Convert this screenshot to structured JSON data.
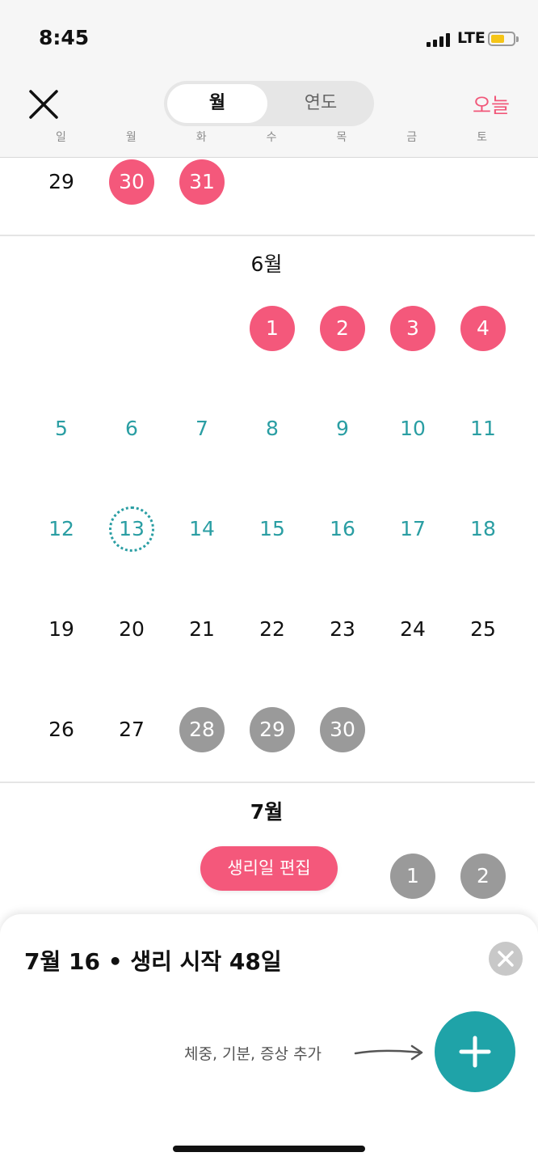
{
  "status_bar": {
    "time": "8:45",
    "network": "LTE"
  },
  "header": {
    "segments": {
      "month": "월",
      "year": "연도"
    },
    "today": "오늘",
    "weekdays": [
      "일",
      "월",
      "화",
      "수",
      "목",
      "금",
      "토"
    ]
  },
  "calendar": {
    "may_tail": {
      "days": [
        {
          "n": "29",
          "state": "normal"
        },
        {
          "n": "30",
          "state": "period"
        },
        {
          "n": "31",
          "state": "period"
        }
      ]
    },
    "june": {
      "title": "6월",
      "days": [
        {
          "n": "1",
          "state": "period"
        },
        {
          "n": "2",
          "state": "period"
        },
        {
          "n": "3",
          "state": "period"
        },
        {
          "n": "4",
          "state": "period"
        },
        {
          "n": "5",
          "state": "fertile"
        },
        {
          "n": "6",
          "state": "fertile"
        },
        {
          "n": "7",
          "state": "fertile"
        },
        {
          "n": "8",
          "state": "fertile"
        },
        {
          "n": "9",
          "state": "fertile"
        },
        {
          "n": "10",
          "state": "fertile"
        },
        {
          "n": "11",
          "state": "fertile"
        },
        {
          "n": "12",
          "state": "fertile"
        },
        {
          "n": "13",
          "state": "today"
        },
        {
          "n": "14",
          "state": "fertile"
        },
        {
          "n": "15",
          "state": "fertile"
        },
        {
          "n": "16",
          "state": "fertile"
        },
        {
          "n": "17",
          "state": "fertile"
        },
        {
          "n": "18",
          "state": "fertile"
        },
        {
          "n": "19",
          "state": "normal"
        },
        {
          "n": "20",
          "state": "normal"
        },
        {
          "n": "21",
          "state": "normal"
        },
        {
          "n": "22",
          "state": "normal"
        },
        {
          "n": "23",
          "state": "normal"
        },
        {
          "n": "24",
          "state": "normal"
        },
        {
          "n": "25",
          "state": "normal"
        },
        {
          "n": "26",
          "state": "normal"
        },
        {
          "n": "27",
          "state": "normal"
        },
        {
          "n": "28",
          "state": "predicted"
        },
        {
          "n": "29",
          "state": "predicted"
        },
        {
          "n": "30",
          "state": "predicted"
        }
      ]
    },
    "july": {
      "title": "7월",
      "days": [
        {
          "n": "1",
          "state": "predicted"
        },
        {
          "n": "2",
          "state": "predicted"
        }
      ]
    },
    "edit_period_label": "생리일 편집"
  },
  "sheet": {
    "title": "7월 16 • 생리 시작 48일",
    "hint": "체중, 기분, 증상 추가"
  },
  "colors": {
    "period": "#f4587b",
    "predicted": "#9a9a9a",
    "fertile": "#2a9ea3",
    "add_button": "#1fa3a8"
  }
}
